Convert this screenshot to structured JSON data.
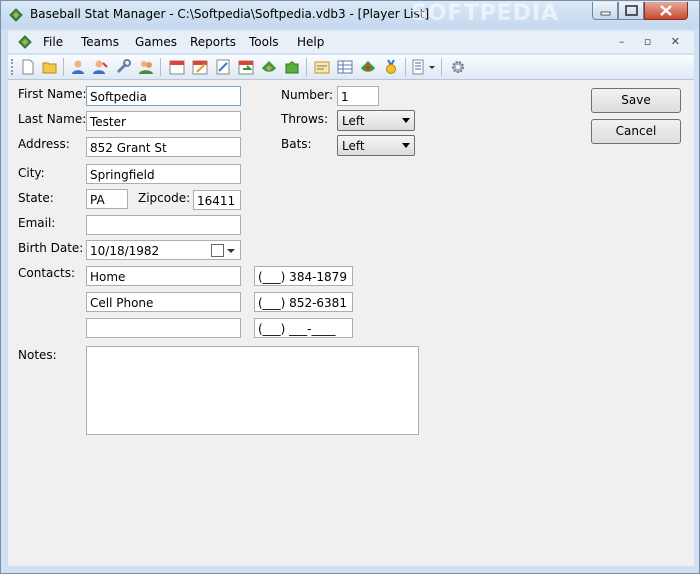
{
  "window": {
    "title": "Baseball Stat Manager - C:\\Softpedia\\Softpedia.vdb3 - [Player List]",
    "watermark": "SOFTPEDIA"
  },
  "menu": {
    "items": [
      "File",
      "Teams",
      "Games",
      "Reports",
      "Tools",
      "Help"
    ]
  },
  "toolbar": {
    "icons": [
      "new-icon",
      "open-icon",
      "player-icon",
      "player-edit-icon",
      "tools-icon",
      "team-icon",
      "calendar-icon",
      "schedule-edit-icon",
      "notes-edit-icon",
      "calendar-arrow-icon",
      "field-icon",
      "puzzle-icon",
      "report-icon",
      "grid-icon",
      "field-stat-icon",
      "medal-icon",
      "view-dropdown-icon",
      "settings-icon"
    ]
  },
  "form": {
    "first_name": {
      "label": "First Name:",
      "value": "Softpedia"
    },
    "last_name": {
      "label": "Last Name:",
      "value": "Tester"
    },
    "address": {
      "label": "Address:",
      "value": "852 Grant St"
    },
    "city": {
      "label": "City:",
      "value": "Springfield"
    },
    "state": {
      "label": "State:",
      "value": "PA"
    },
    "zipcode": {
      "label": "Zipcode:",
      "value": "16411"
    },
    "email": {
      "label": "Email:",
      "value": ""
    },
    "birth_date": {
      "label": "Birth Date:",
      "value": "10/18/1982"
    },
    "contacts": {
      "label": "Contacts:",
      "rows": [
        {
          "name": "Home",
          "phone": "(___) 384-1879"
        },
        {
          "name": "Cell Phone",
          "phone": "(___) 852-6381"
        },
        {
          "name": "",
          "phone": "(___) ___-____"
        }
      ]
    },
    "notes": {
      "label": "Notes:",
      "value": ""
    },
    "number": {
      "label": "Number:",
      "value": "1"
    },
    "throws": {
      "label": "Throws:",
      "value": "Left"
    },
    "bats": {
      "label": "Bats:",
      "value": "Left"
    }
  },
  "buttons": {
    "save": "Save",
    "cancel": "Cancel"
  }
}
